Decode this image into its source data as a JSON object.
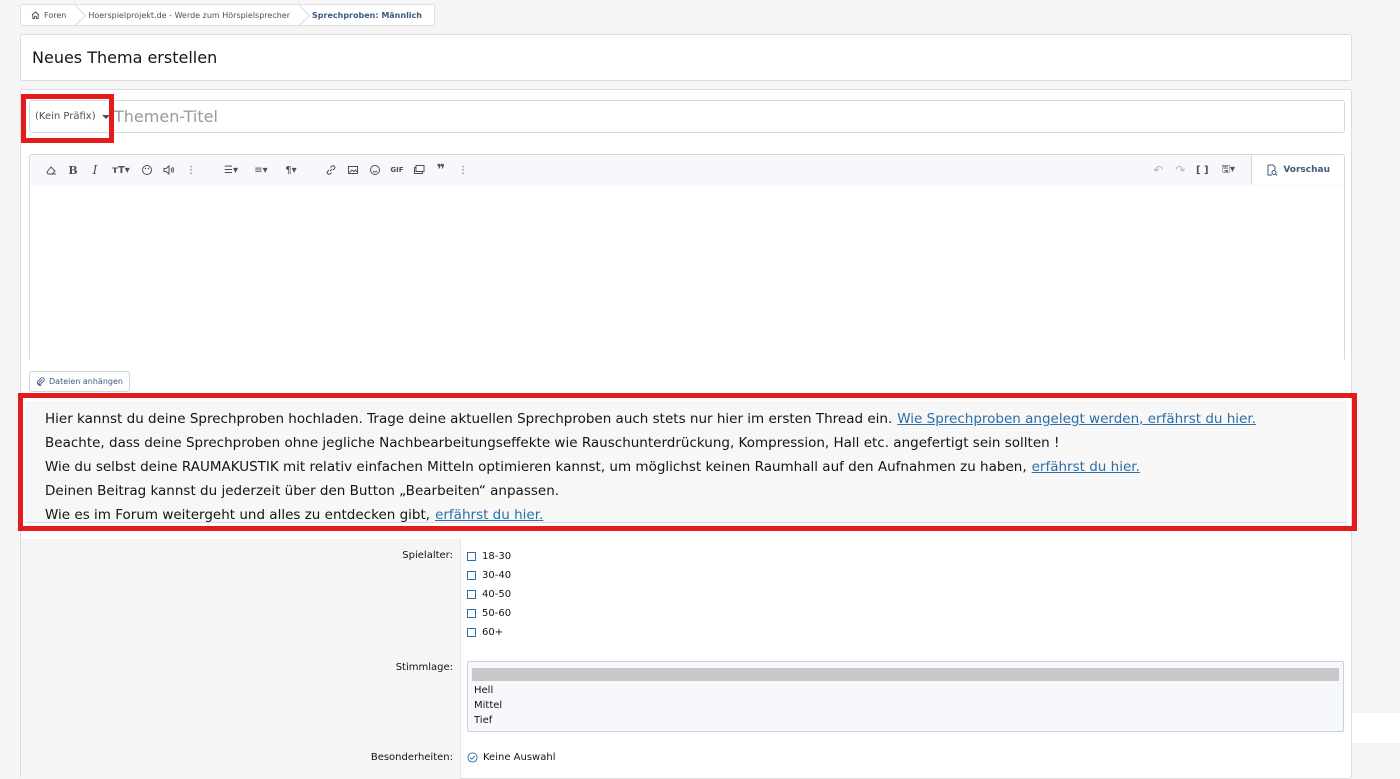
{
  "breadcrumb": {
    "items": [
      {
        "label": "Foren"
      },
      {
        "label": "Hoerspielprojekt.de - Werde zum Hörspielsprecher"
      },
      {
        "label": "Sprechproben: Männlich"
      }
    ]
  },
  "page": {
    "title": "Neues Thema erstellen"
  },
  "thread_form": {
    "prefix_label": "(Kein Präfix)",
    "title_placeholder": "Themen-Titel",
    "preview_label": "Vorschau",
    "toolbar_gif_label": "GIF",
    "attach_label": "Dateien anhängen"
  },
  "info": {
    "lines": [
      {
        "text": "Hier kannst du deine Sprechproben hochladen. Trage deine aktuellen Sprechproben auch stets nur hier im ersten Thread ein.",
        "link": "Wie Sprechproben angelegt werden, erfährst du hier."
      },
      {
        "text": "Beachte, dass deine Sprechproben ohne jegliche Nachbearbeitungseffekte wie Rauschunterdrückung, Kompression, Hall etc. angefertigt sein sollten !",
        "link": ""
      },
      {
        "text": "Wie du selbst deine RAUMAKUSTIK mit relativ einfachen Mitteln optimieren kannst, um möglichst keinen Raumhall auf den Aufnahmen zu haben,",
        "link": "erfährst du hier. "
      },
      {
        "text": "Deinen Beitrag kannst du jederzeit über den Button „Bearbeiten“ anpassen.",
        "link": ""
      },
      {
        "text": "Wie es im Forum weitergeht und alles zu entdecken gibt,",
        "link": "erfährst du hier."
      }
    ]
  },
  "fields": {
    "spielalter": {
      "label": "Spielalter:",
      "options": [
        "18-30",
        "30-40",
        "40-50",
        "50-60",
        "60+"
      ]
    },
    "stimmlage": {
      "label": "Stimmlage:",
      "options": [
        "Hell",
        "Mittel",
        "Tief"
      ]
    },
    "besonderheiten": {
      "label": "Besonderheiten:",
      "value": "Keine Auswahl"
    }
  },
  "colors": {
    "highlight": "#e41b1b",
    "link": "#2b6ea8",
    "accent": "#3c5b7e"
  }
}
